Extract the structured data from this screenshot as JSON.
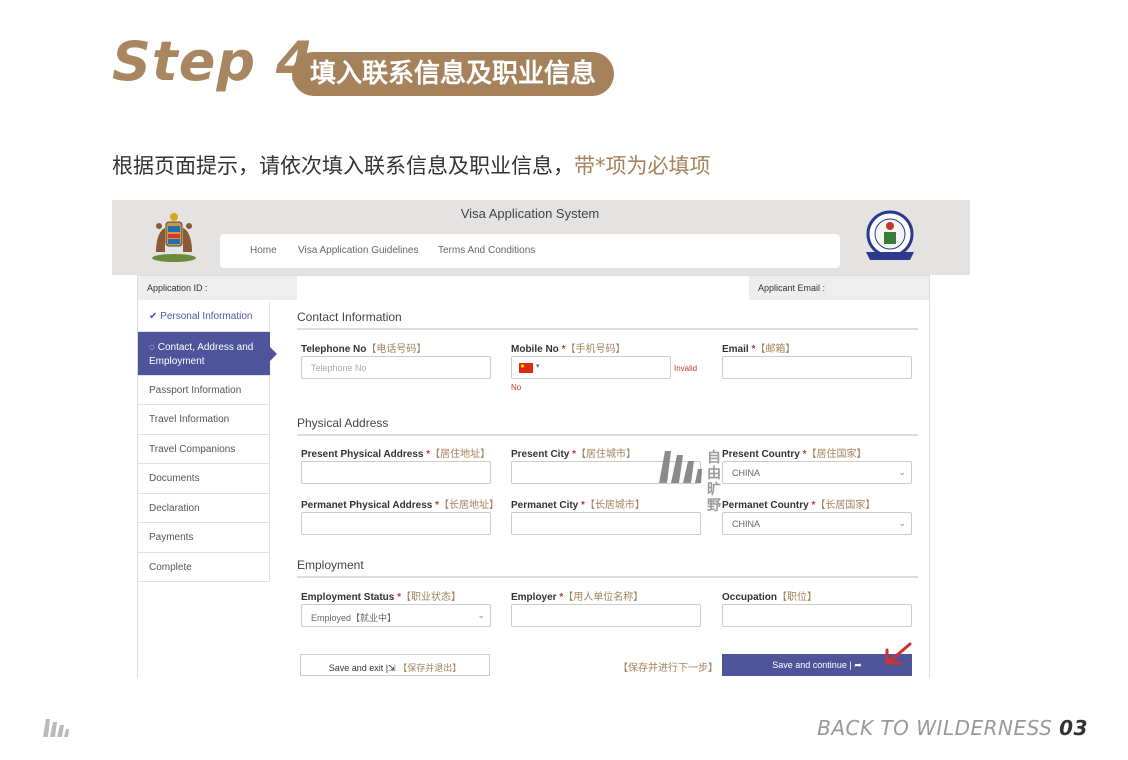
{
  "header": {
    "step": "Step 4",
    "pill": "填入联系信息及职业信息",
    "instruction": "根据页面提示，请依次填入联系信息及职业信息，",
    "instruction_highlight": "带*项为必填项"
  },
  "app": {
    "system_title": "Visa Application System",
    "nav": [
      "Home",
      "Visa Application Guidelines",
      "Terms And Conditions"
    ],
    "application_id_label": "Application ID :",
    "applicant_email_label": "Applicant Email :",
    "sidebar": [
      {
        "label": "Personal Information",
        "state": "done"
      },
      {
        "label": "Contact, Address and Employment",
        "state": "active"
      },
      {
        "label": "Passport Information",
        "state": ""
      },
      {
        "label": "Travel Information",
        "state": ""
      },
      {
        "label": "Travel Companions",
        "state": ""
      },
      {
        "label": "Documents",
        "state": ""
      },
      {
        "label": "Declaration",
        "state": ""
      },
      {
        "label": "Payments",
        "state": ""
      },
      {
        "label": "Complete",
        "state": ""
      }
    ],
    "contact": {
      "title": "Contact Information",
      "telephone_label": "Telephone No",
      "telephone_cn": "【电话号码】",
      "telephone_placeholder": "Telephone No",
      "mobile_label": "Mobile No",
      "mobile_cn": "【手机号码】",
      "mobile_invalid": "Invalid",
      "mobile_invalid_2": "No",
      "email_label": "Email",
      "email_cn": "【邮箱】"
    },
    "address": {
      "title": "Physical Address",
      "present_address_label": "Present Physical Address",
      "present_address_cn": "【居住地址】",
      "present_city_label": "Present City",
      "present_city_cn": "【居住城市】",
      "present_country_label": "Present Country",
      "present_country_cn": "【居住国家】",
      "present_country_value": "CHINA",
      "permanent_address_label": "Permanet Physical Address",
      "permanent_address_cn": "【长居地址】",
      "permanent_city_label": "Permanet City",
      "permanent_city_cn": "【长居城市】",
      "permanent_country_label": "Permanet Country",
      "permanent_country_cn": "【长居国家】",
      "permanent_country_value": "CHINA"
    },
    "employment": {
      "title": "Employment",
      "status_label": "Employment Status",
      "status_cn": "【职业状态】",
      "status_value": "Employed【就业中】",
      "employer_label": "Employer",
      "employer_cn": "【用人单位名称】",
      "occupation_label": "Occupation",
      "occupation_cn": "【职位】"
    },
    "required_mark": "*",
    "buttons": {
      "save_exit": "Save and exit |",
      "save_exit_cn": "【保存并退出】",
      "continue_cn": "【保存并进行下一步】",
      "continue": "Save and continue |"
    }
  },
  "watermark": {
    "line1": "自由",
    "line2": "旷野"
  },
  "footer": {
    "text": "BACK TO WILDERNESS",
    "page": "03"
  },
  "colors": {
    "accent": "#a5825c",
    "primary": "#4d549a",
    "error": "#c0392b",
    "arrow": "#d0312d"
  }
}
